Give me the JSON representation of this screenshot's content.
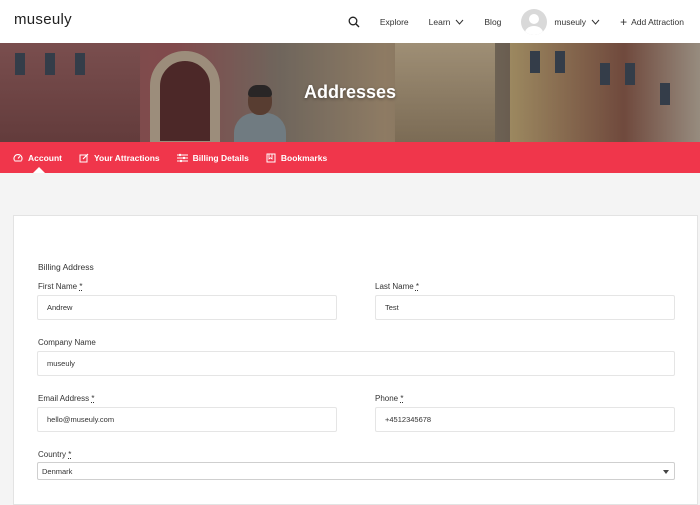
{
  "header": {
    "logo": "museuly",
    "nav": {
      "search_icon": "search-icon",
      "explore": "Explore",
      "learn": "Learn",
      "blog": "Blog",
      "user": "museuly",
      "add_attraction": "Add Attraction"
    }
  },
  "hero": {
    "title": "Addresses"
  },
  "tabs": [
    {
      "label": "Account",
      "icon": "dashboard-icon"
    },
    {
      "label": "Your Attractions",
      "icon": "edit-icon"
    },
    {
      "label": "Billing Details",
      "icon": "list-icon"
    },
    {
      "label": "Bookmarks",
      "icon": "bookmark-icon"
    }
  ],
  "form": {
    "section_title": "Billing Address",
    "first_name": {
      "label": "First Name",
      "required": "*",
      "value": "Andrew"
    },
    "last_name": {
      "label": "Last Name",
      "required": "*",
      "value": "Test"
    },
    "company": {
      "label": "Company Name",
      "value": "museuly"
    },
    "email": {
      "label": "Email Address",
      "required": "*",
      "value": "hello@museuly.com"
    },
    "phone": {
      "label": "Phone",
      "required": "*",
      "value": "+4512345678"
    },
    "country": {
      "label": "Country",
      "required": "*",
      "value": "Denmark"
    }
  },
  "colors": {
    "accent": "#f0364b"
  }
}
